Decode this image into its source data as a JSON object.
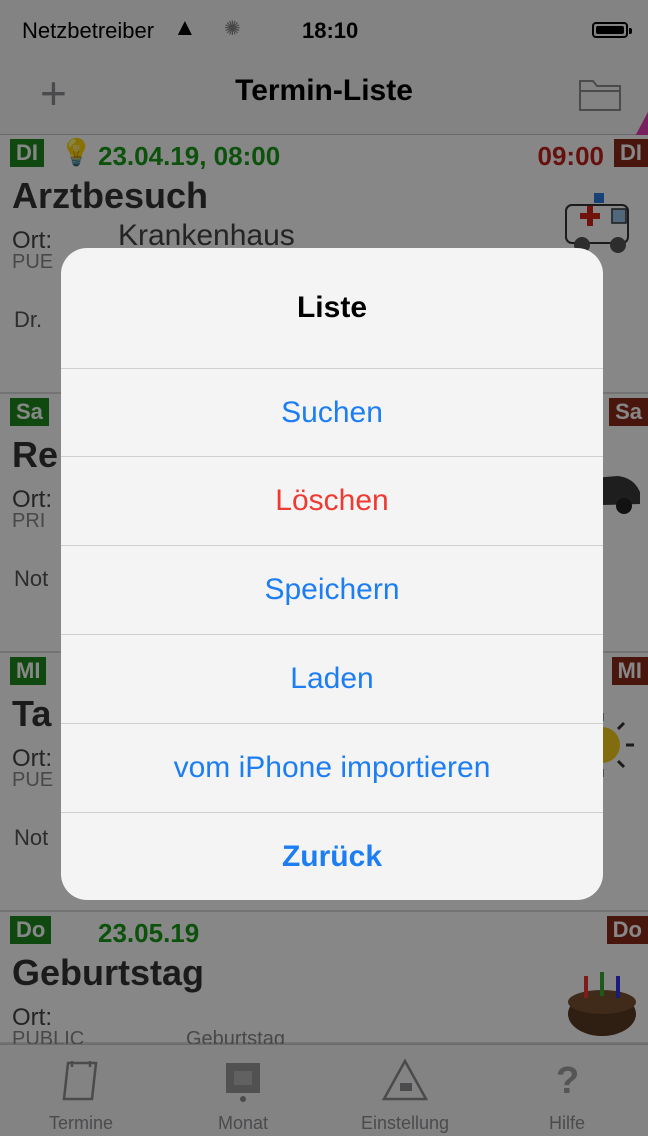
{
  "status_bar": {
    "carrier": "Netzbetreiber",
    "time": "18:10"
  },
  "nav": {
    "title": "Termin-Liste"
  },
  "rows": [
    {
      "day_left": "DI",
      "day_right": "DI",
      "date": "23.04.19, 08:00",
      "end_time": "09:00",
      "title": "Arztbesuch",
      "ort_label": "Ort:",
      "ort_value": "Krankenhaus",
      "visibility": "PUE",
      "note": "Dr."
    },
    {
      "day_left": "Sa",
      "day_right": "Sa",
      "title": "Re",
      "ort_label": "Ort:",
      "visibility": "PRI",
      "note": "Not"
    },
    {
      "day_left": "MI",
      "day_right": "MI",
      "title": "Ta",
      "ort_label": "Ort:",
      "visibility": "PUE",
      "note": "Not"
    },
    {
      "day_left": "Do",
      "day_right": "Do",
      "date": "23.05.19",
      "title": "Geburtstag",
      "ort_label": "Ort:",
      "visibility": "PUBLIC",
      "category": "Geburtstag"
    }
  ],
  "tabs": [
    {
      "label": "Termine",
      "icon": "calendar-icon"
    },
    {
      "label": "Monat",
      "icon": "month-icon"
    },
    {
      "label": "Einstellung",
      "icon": "settings-icon"
    },
    {
      "label": "Hilfe",
      "icon": "help-icon"
    }
  ],
  "alert": {
    "title": "Liste",
    "buttons": [
      "Suchen",
      "Löschen",
      "Speichern",
      "Laden",
      "vom iPhone importieren",
      "Zurück"
    ]
  },
  "colors": {
    "link_blue": "#1c7ef2",
    "destructive_red": "#ee3a33",
    "date_green": "#179c17",
    "day_badge_green": "#1f8b1f",
    "day_badge_red": "#8b2a1a"
  }
}
